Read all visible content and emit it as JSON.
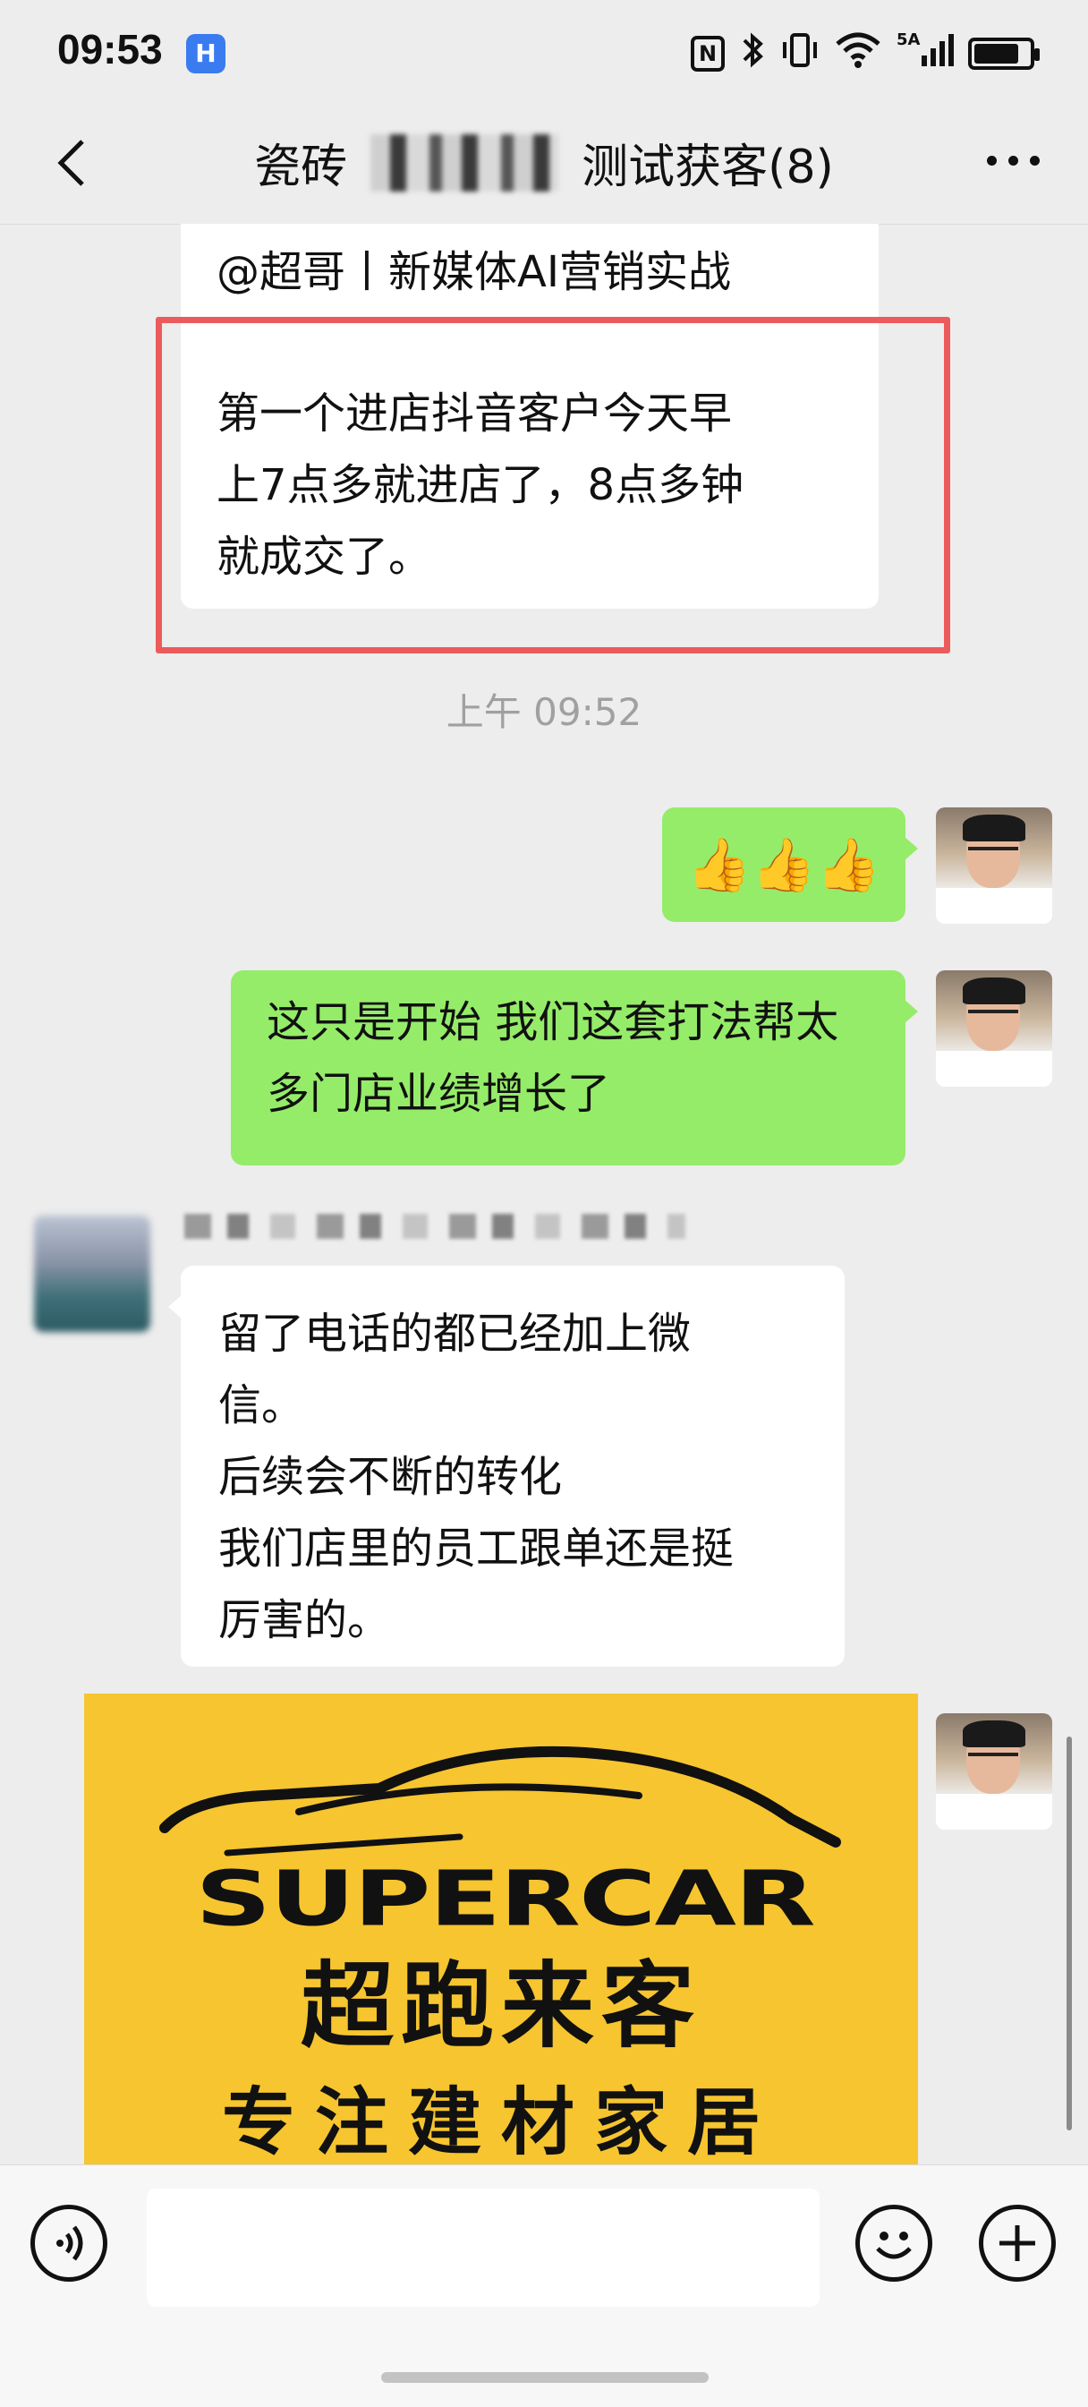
{
  "status_bar": {
    "time": "09:53",
    "app_icon": "H",
    "icons": [
      "nfc-icon",
      "bluetooth-icon",
      "vibrate-icon",
      "wifi-icon",
      "signal-5a-icon",
      "battery-icon"
    ],
    "nfc": "N",
    "signal_label": "5A",
    "battery_level": 0.85
  },
  "nav": {
    "back_icon": "chevron-left-icon",
    "title_prefix": "瓷砖",
    "title_suffix": "测试获客(8)",
    "more_icon": "more-dots-icon"
  },
  "messages": {
    "quote": {
      "sender": "@超哥丨新媒体AI营销实战",
      "text": "第一个进店抖音客户今天早\n上7点多就进店了，8点多钟\n就成交了。"
    },
    "timestamp": "上午 09:52",
    "reply_thumbs": "👍👍👍",
    "reply_text": "这只是开始 我们这套打法帮太多门店业绩增长了",
    "other_reply": "留了电话的都已经加上微\n信。\n后续会不断的转化\n我们店里的员工跟单还是挺\n厉害的。",
    "image": {
      "brand_en": "SUPERCAR",
      "brand_cn": "超跑来客",
      "tagline": "专注建材家居"
    }
  },
  "input_bar": {
    "voice_icon": "voice-icon",
    "emoji_icon": "emoji-icon",
    "plus_icon": "plus-icon"
  },
  "colors": {
    "green_bubble": "#95ec69",
    "highlight_red": "#ec5b5b",
    "logo_yellow": "#f6c52f"
  }
}
